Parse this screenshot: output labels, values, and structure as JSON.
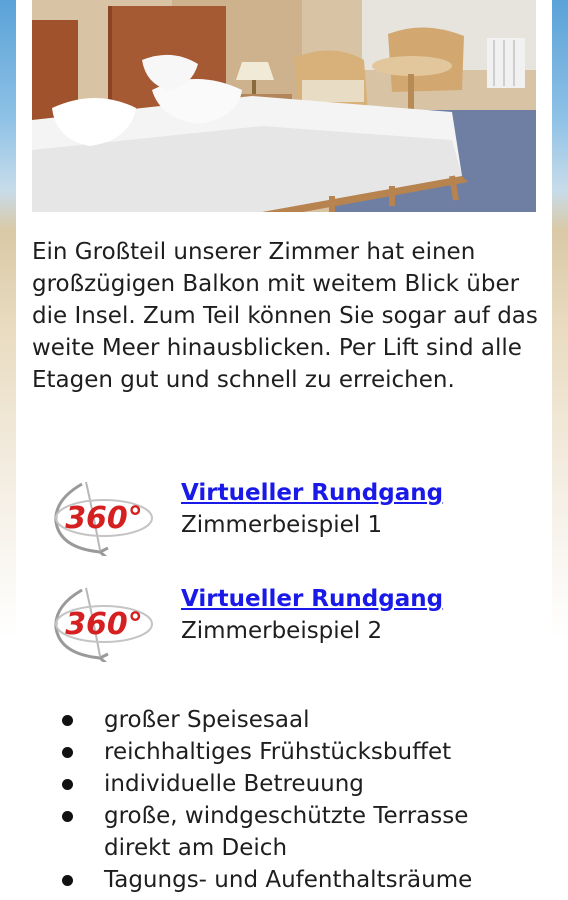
{
  "hero": {
    "alt": "Hotel room with double bed, armchairs and table"
  },
  "intro": {
    "text": "Ein Großteil unserer Zimmer hat einen großzügigen Balkon mit weitem Blick über die Insel. Zum Teil können Sie sogar auf das weite Meer hinausblicken. Per Lift sind alle Etagen gut und schnell zu erreichen."
  },
  "tours": [
    {
      "badge": "360°",
      "link": "Virtueller Rundgang",
      "subtitle": "Zimmerbeispiel 1"
    },
    {
      "badge": "360°",
      "link": "Virtueller Rundgang",
      "subtitle": "Zimmerbeispiel 2"
    }
  ],
  "features": [
    "großer Speisesaal",
    "reichhaltiges Frühstücksbuffet",
    "individuelle Betreuung",
    "große, windgeschützte Terrasse direkt am Deich",
    "Tagungs- und Aufenthaltsräume"
  ],
  "colors": {
    "link": "#1a1ae8",
    "badge_red": "#d42020",
    "text": "#1e1e1e"
  },
  "icons": {
    "tour_badge": "360-degree-icon"
  }
}
